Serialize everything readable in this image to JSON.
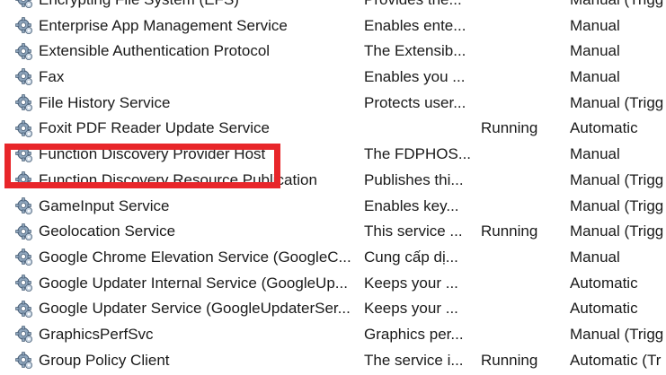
{
  "services": [
    {
      "name": "Encrypting File System (EFS)",
      "description": "Provides the...",
      "status": "",
      "startup": "Manual (Trigg",
      "icon": "gear-service-icon"
    },
    {
      "name": "Enterprise App Management Service",
      "description": "Enables ente...",
      "status": "",
      "startup": "Manual",
      "icon": "gear-service-icon"
    },
    {
      "name": "Extensible Authentication Protocol",
      "description": "The Extensib...",
      "status": "",
      "startup": "Manual",
      "icon": "gear-service-icon"
    },
    {
      "name": "Fax",
      "description": "Enables you ...",
      "status": "",
      "startup": "Manual",
      "icon": "gear-service-icon"
    },
    {
      "name": "File History Service",
      "description": "Protects user...",
      "status": "",
      "startup": "Manual (Trigg",
      "icon": "gear-service-icon"
    },
    {
      "name": "Foxit PDF Reader Update Service",
      "description": "",
      "status": "Running",
      "startup": "Automatic",
      "icon": "gear-service-icon"
    },
    {
      "name": "Function Discovery Provider Host",
      "description": "The FDPHOS...",
      "status": "",
      "startup": "Manual",
      "icon": "gear-service-icon"
    },
    {
      "name": "Function Discovery Resource Publication",
      "description": "Publishes thi...",
      "status": "",
      "startup": "Manual (Trigg",
      "icon": "gear-service-icon"
    },
    {
      "name": "GameInput Service",
      "description": "Enables key...",
      "status": "",
      "startup": "Manual (Trigg",
      "icon": "gear-service-icon"
    },
    {
      "name": "Geolocation Service",
      "description": "This service ...",
      "status": "Running",
      "startup": "Manual (Trigg",
      "icon": "gear-service-icon"
    },
    {
      "name": "Google Chrome Elevation Service (GoogleC...",
      "description": "Cung cấp dị...",
      "status": "",
      "startup": "Manual",
      "icon": "gear-service-icon"
    },
    {
      "name": "Google Updater Internal Service (GoogleUp...",
      "description": "Keeps your ...",
      "status": "",
      "startup": "Automatic",
      "icon": "gear-service-icon"
    },
    {
      "name": "Google Updater Service (GoogleUpdaterSer...",
      "description": "Keeps your ...",
      "status": "",
      "startup": "Automatic",
      "icon": "gear-service-icon"
    },
    {
      "name": "GraphicsPerfSvc",
      "description": "Graphics per...",
      "status": "",
      "startup": "Manual (Trigg",
      "icon": "gear-service-icon"
    },
    {
      "name": "Group Policy Client",
      "description": "The service i...",
      "status": "Running",
      "startup": "Automatic (Tr",
      "icon": "gear-service-icon"
    }
  ],
  "highlight_color": "#e8262a"
}
